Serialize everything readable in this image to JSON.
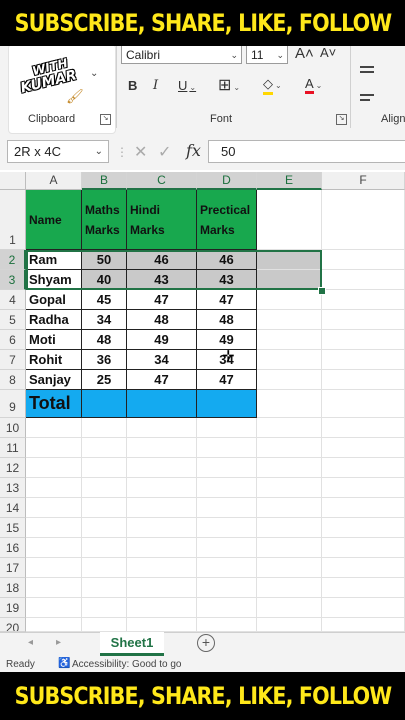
{
  "banner": {
    "top": "SUBSCRIBE, SHARE, LIKE, FOLLOW",
    "bottom": "SUBSCRIBE, SHARE, LIKE, FOLLOW"
  },
  "logo": {
    "line1": "WITH",
    "line2": "KUMAR"
  },
  "ribbon": {
    "clipboard_label": "Clipboard",
    "font_label": "Font",
    "alignment_label": "Align",
    "font_name": "Calibri",
    "font_size": "11",
    "grow_font": "A˄",
    "shrink_font": "A˅",
    "bold": "B",
    "italic": "I",
    "underline": "U",
    "font_color_glyph": "A",
    "fill_glyph": "◇",
    "borders_glyph": "⊞",
    "colors": {
      "fill": "#ffd700",
      "font": "#e81123"
    }
  },
  "formula_bar": {
    "name_box": "2R x 4C",
    "fx": "fx",
    "value": "50"
  },
  "columns": [
    "A",
    "B",
    "C",
    "D",
    "E",
    "F"
  ],
  "rows": [
    "1",
    "2",
    "3",
    "4",
    "5",
    "6",
    "7",
    "8",
    "9",
    "10",
    "11",
    "12",
    "13",
    "14",
    "15",
    "16",
    "17",
    "18",
    "19",
    "20"
  ],
  "table": {
    "header": {
      "name": "Name",
      "maths": "Maths Marks",
      "hindi": "Hindi Marks",
      "prectical": "Prectical Marks"
    },
    "rows": [
      {
        "name": "Ram",
        "maths": "50",
        "hindi": "46",
        "prectical": "46"
      },
      {
        "name": "Shyam",
        "maths": "40",
        "hindi": "43",
        "prectical": "43"
      },
      {
        "name": "Gopal",
        "maths": "45",
        "hindi": "47",
        "prectical": "47"
      },
      {
        "name": "Radha",
        "maths": "34",
        "hindi": "48",
        "prectical": "48"
      },
      {
        "name": "Moti",
        "maths": "48",
        "hindi": "49",
        "prectical": "49"
      },
      {
        "name": "Rohit",
        "maths": "36",
        "hindi": "34",
        "prectical": "34"
      },
      {
        "name": "Sanjay",
        "maths": "25",
        "hindi": "47",
        "prectical": "47"
      }
    ],
    "total_label": "Total"
  },
  "sheet_tab": "Sheet1",
  "add_sheet": "+",
  "status": {
    "ready": "Ready",
    "accessibility": "Accessibility: Good to go"
  },
  "theme": {
    "header_green": "#18a84e",
    "total_blue": "#14aaf0",
    "excel_green": "#217346"
  }
}
